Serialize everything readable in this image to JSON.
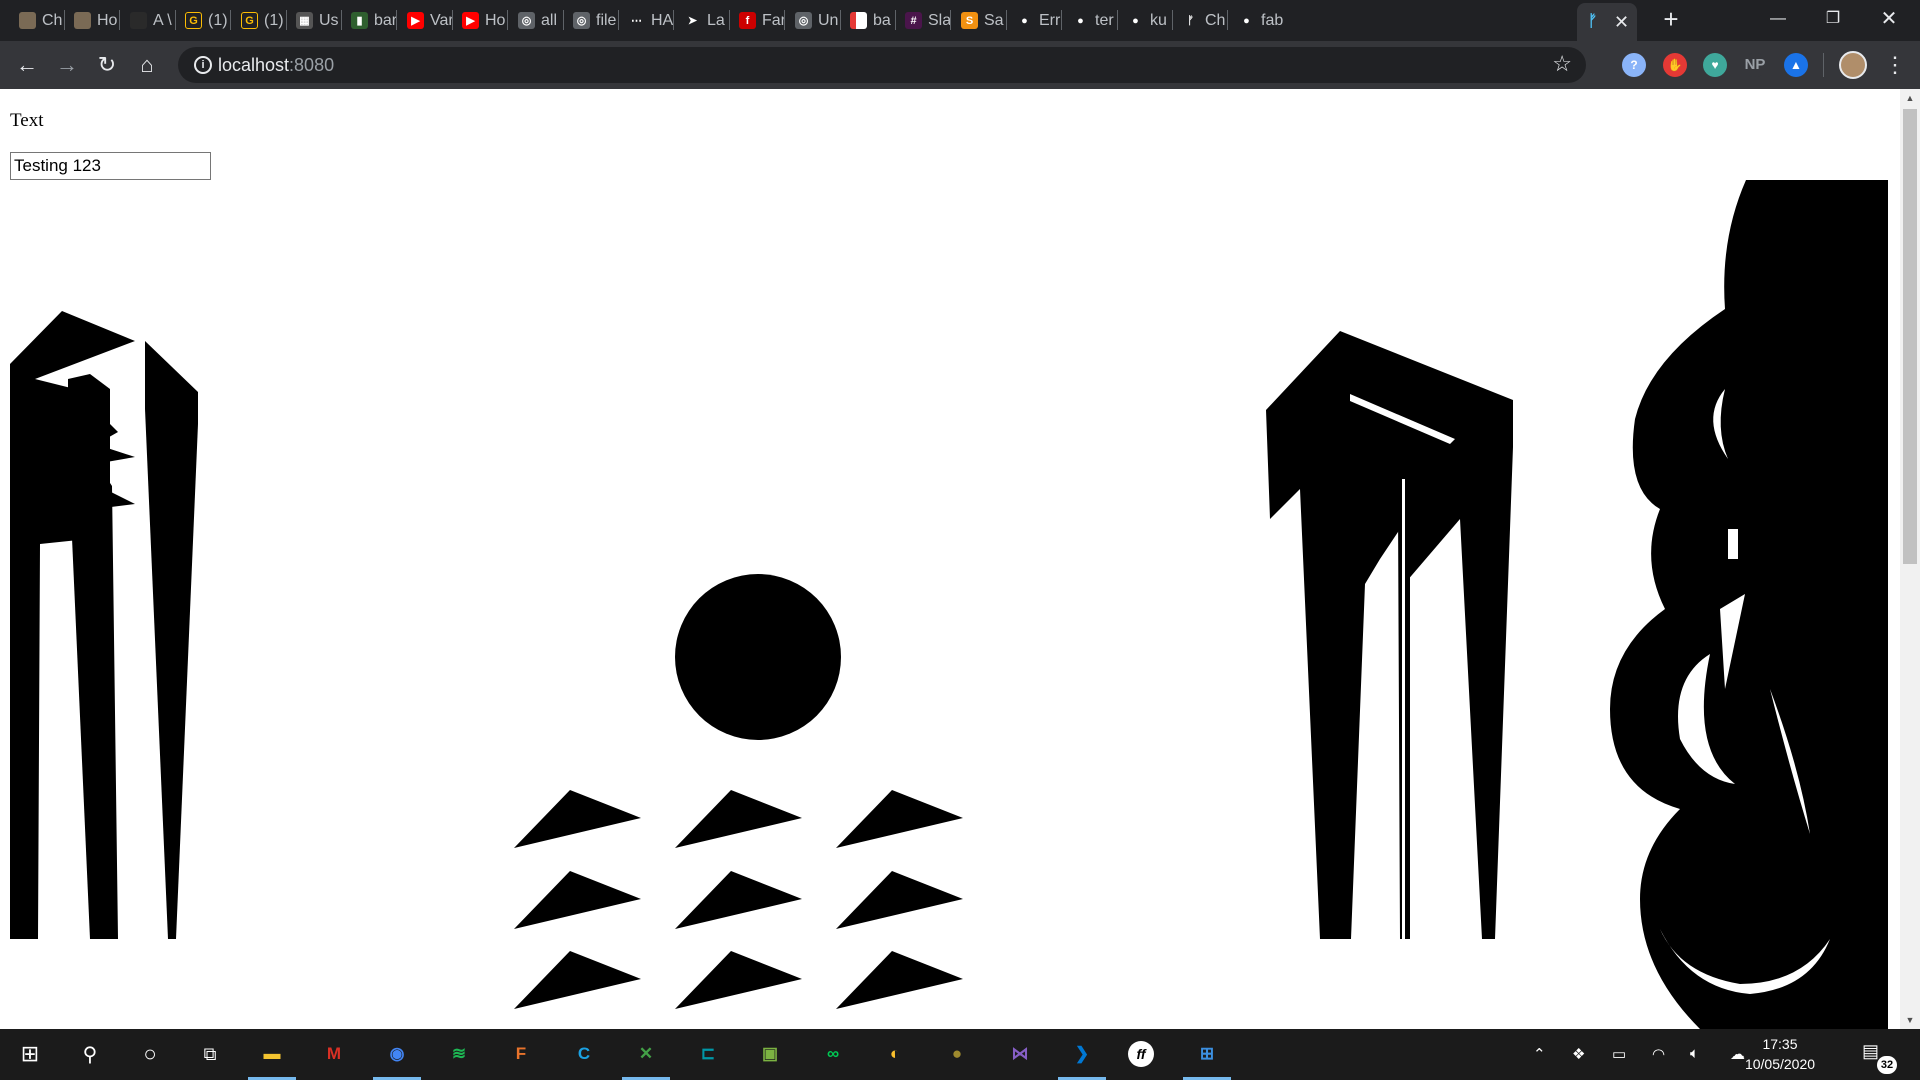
{
  "browser": {
    "tabs": [
      {
        "title": "Ch",
        "icon": "image-favicon-icon",
        "color": "#7a6a55",
        "glyph": ""
      },
      {
        "title": "Ho",
        "icon": "image-favicon-icon",
        "color": "#7a6a55",
        "glyph": ""
      },
      {
        "title": "A \\",
        "icon": "dark-circle-favicon-icon",
        "color": "#2a2a2a",
        "glyph": ""
      },
      {
        "title": "(1)",
        "icon": "g-favicon-icon",
        "color": "#202124",
        "glyph": "G"
      },
      {
        "title": "(1)",
        "icon": "g-favicon-icon",
        "color": "#202124",
        "glyph": "G"
      },
      {
        "title": "Us",
        "icon": "grid-favicon-icon",
        "color": "#555555",
        "glyph": "▦"
      },
      {
        "title": "bar",
        "icon": "bar-favicon-icon",
        "color": "#2f5f2f",
        "glyph": "▮"
      },
      {
        "title": "Var",
        "icon": "youtube-icon",
        "color": "#ff0000",
        "glyph": "▶"
      },
      {
        "title": "Ho",
        "icon": "youtube-icon",
        "color": "#ff0000",
        "glyph": "▶"
      },
      {
        "title": "all",
        "icon": "globe-icon",
        "color": "#5f6368",
        "glyph": "◎"
      },
      {
        "title": "file",
        "icon": "globe-icon",
        "color": "#5f6368",
        "glyph": "◎"
      },
      {
        "title": "HA",
        "icon": "dots-favicon-icon",
        "color": "#202124",
        "glyph": "⋯"
      },
      {
        "title": "La",
        "icon": "cursor-favicon-icon",
        "color": "#202124",
        "glyph": "➤"
      },
      {
        "title": "Far",
        "icon": "red-favicon-icon",
        "color": "#cc0000",
        "glyph": "f"
      },
      {
        "title": "Un",
        "icon": "globe-icon",
        "color": "#5f6368",
        "glyph": "◎"
      },
      {
        "title": "ba",
        "icon": "white-red-favicon-icon",
        "color": "#ffffff",
        "glyph": ""
      },
      {
        "title": "Sla",
        "icon": "slack-icon",
        "color": "#4a154b",
        "glyph": "#"
      },
      {
        "title": "Sa",
        "icon": "s-favicon-icon",
        "color": "#f29111",
        "glyph": "S"
      },
      {
        "title": "Err",
        "icon": "github-icon",
        "color": "#202124",
        "glyph": "●"
      },
      {
        "title": "ter",
        "icon": "github-icon",
        "color": "#202124",
        "glyph": "●"
      },
      {
        "title": "ku",
        "icon": "github-icon",
        "color": "#202124",
        "glyph": "●"
      },
      {
        "title": "Ch",
        "icon": "fabric-favicon-icon",
        "color": "#202124",
        "glyph": "ᚠ"
      },
      {
        "title": "fab",
        "icon": "github-icon",
        "color": "#202124",
        "glyph": "●"
      }
    ],
    "active_tab_icon": "fabric-favicon-icon",
    "url_host": "localhost",
    "url_port": ":8080",
    "extensions": [
      {
        "name": "shield-extension-icon",
        "label": "?",
        "color": "#8ab4f8"
      },
      {
        "name": "adblock-extension-icon",
        "label": "✋",
        "color": "#e53935"
      },
      {
        "name": "heart-extension-icon",
        "label": "♥",
        "color": "#3fa89b"
      },
      {
        "name": "np-extension-icon",
        "label": "NP",
        "color": "#35363a"
      },
      {
        "name": "drop-extension-icon",
        "label": "▲",
        "color": "#1a73e8"
      }
    ]
  },
  "page": {
    "label": "Text",
    "input_value": "Testing 123"
  },
  "taskbar": {
    "apps": [
      {
        "name": "file-explorer-icon",
        "glyph": "▬",
        "color": "#f4c430",
        "active": true
      },
      {
        "name": "gmail-icon",
        "glyph": "M",
        "color": "#d93025",
        "active": false
      },
      {
        "name": "chrome-icon",
        "glyph": "◉",
        "color": "#4285f4",
        "active": true
      },
      {
        "name": "spotify-icon",
        "glyph": "≋",
        "color": "#1db954",
        "active": false
      },
      {
        "name": "f-app-icon",
        "glyph": "F",
        "color": "#e8732b",
        "active": false
      },
      {
        "name": "c-app-icon",
        "glyph": "C",
        "color": "#1ba1e2",
        "active": false
      },
      {
        "name": "x-app-icon",
        "glyph": "✕",
        "color": "#43a047",
        "active": true
      },
      {
        "name": "terminal-app-icon",
        "glyph": "⊏",
        "color": "#0097a7",
        "active": false
      },
      {
        "name": "photo-app-icon",
        "glyph": "▣",
        "color": "#7cb342",
        "active": false
      },
      {
        "name": "infinity-app-icon",
        "glyph": "∞",
        "color": "#00c853",
        "active": false
      },
      {
        "name": "bulb-app-icon",
        "glyph": "◐",
        "color": "#fbc02d",
        "active": false
      },
      {
        "name": "ball-app-icon",
        "glyph": "●",
        "color": "#9e8a2e",
        "active": false
      },
      {
        "name": "visual-studio-icon",
        "glyph": "⋈",
        "color": "#865fc5",
        "active": false
      },
      {
        "name": "vscode-icon",
        "glyph": "❯",
        "color": "#0078d4",
        "active": true
      },
      {
        "name": "ff-app-icon",
        "glyph": "ff",
        "color": "#ffffff",
        "active": false
      },
      {
        "name": "windows-logo-app-icon",
        "glyph": "⊞",
        "color": "#3c8fe0",
        "active": true
      }
    ],
    "time": "17:35",
    "date": "10/05/2020",
    "notification_count": "32"
  }
}
